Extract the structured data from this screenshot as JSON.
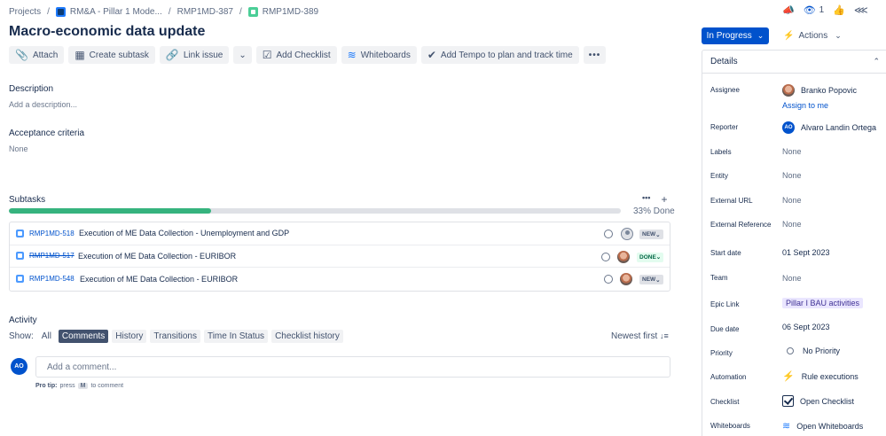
{
  "breadcrumbs": [
    {
      "label": "Projects"
    },
    {
      "label": "RM&A - Pillar 1 Mode..."
    },
    {
      "label": "RMP1MD-387"
    },
    {
      "label": "RMP1MD-389"
    }
  ],
  "issue": {
    "title": "Macro-economic data update"
  },
  "toolbar": {
    "attach": "Attach",
    "create_subtask": "Create subtask",
    "link_issue": "Link issue",
    "add_checklist": "Add Checklist",
    "whiteboards": "Whiteboards",
    "add_tempo": "Add Tempo to plan and track time"
  },
  "description": {
    "heading": "Description",
    "placeholder": "Add a description..."
  },
  "acceptance": {
    "heading": "Acceptance criteria",
    "value": "None"
  },
  "subtasks": {
    "heading": "Subtasks",
    "progress_fraction": 0.33,
    "progress_label": "33% Done",
    "rows": [
      {
        "key": "RMP1MD-518",
        "summary": "Execution of ME Data Collection - Unemployment and GDP",
        "status": "NEW",
        "done": false,
        "assignee": "unassigned"
      },
      {
        "key": "RMP1MD-517",
        "summary": "Execution of ME Data Collection - EURIBOR",
        "status": "DONE",
        "done": true,
        "assignee": "photo"
      },
      {
        "key": "RMP1MD-548",
        "summary": "Execution of ME Data Collection - EURIBOR",
        "status": "NEW",
        "done": false,
        "assignee": "photo"
      }
    ]
  },
  "activity": {
    "heading": "Activity",
    "show_label": "Show:",
    "tabs": [
      {
        "label": "All",
        "active": false
      },
      {
        "label": "Comments",
        "active": true
      },
      {
        "label": "History",
        "active": false
      },
      {
        "label": "Transitions",
        "active": false
      },
      {
        "label": "Time In Status",
        "active": false
      },
      {
        "label": "Checklist history",
        "active": false
      }
    ],
    "sort_label": "Newest first",
    "user_initials": "AO",
    "comment_placeholder": "Add a comment...",
    "protip_bold": "Pro tip:",
    "protip_pre": "press",
    "protip_key": "M",
    "protip_post": "to comment"
  },
  "header_icons": {
    "watchers_count": "1"
  },
  "status": {
    "label": "In Progress"
  },
  "actions_label": "Actions",
  "details": {
    "heading": "Details",
    "assignee": {
      "label": "Assignee",
      "value": "Branko Popovic",
      "assign_to_me": "Assign to me"
    },
    "reporter": {
      "label": "Reporter",
      "value": "Alvaro Landin Ortega",
      "initials": "AO"
    },
    "labels": {
      "label": "Labels",
      "value": "None"
    },
    "entity": {
      "label": "Entity",
      "value": "None"
    },
    "external_url": {
      "label": "External URL",
      "value": "None"
    },
    "external_reference": {
      "label": "External Reference",
      "value": "None"
    },
    "start_date": {
      "label": "Start date",
      "value": "01 Sept 2023"
    },
    "team": {
      "label": "Team",
      "value": "None"
    },
    "epic_link": {
      "label": "Epic Link",
      "value": "Pillar I BAU activities"
    },
    "due_date": {
      "label": "Due date",
      "value": "06 Sept 2023"
    },
    "priority": {
      "label": "Priority",
      "value": "No Priority"
    },
    "automation": {
      "label": "Automation",
      "value": "Rule executions"
    },
    "checklist": {
      "label": "Checklist",
      "value": "Open Checklist"
    },
    "whiteboards": {
      "label": "Whiteboards",
      "value": "Open Whiteboards"
    }
  },
  "colors": {
    "primary": "#0052cc",
    "progress": "#36b37e",
    "done_lozenge": "#e3fcef",
    "epic": "#eae6ff"
  }
}
